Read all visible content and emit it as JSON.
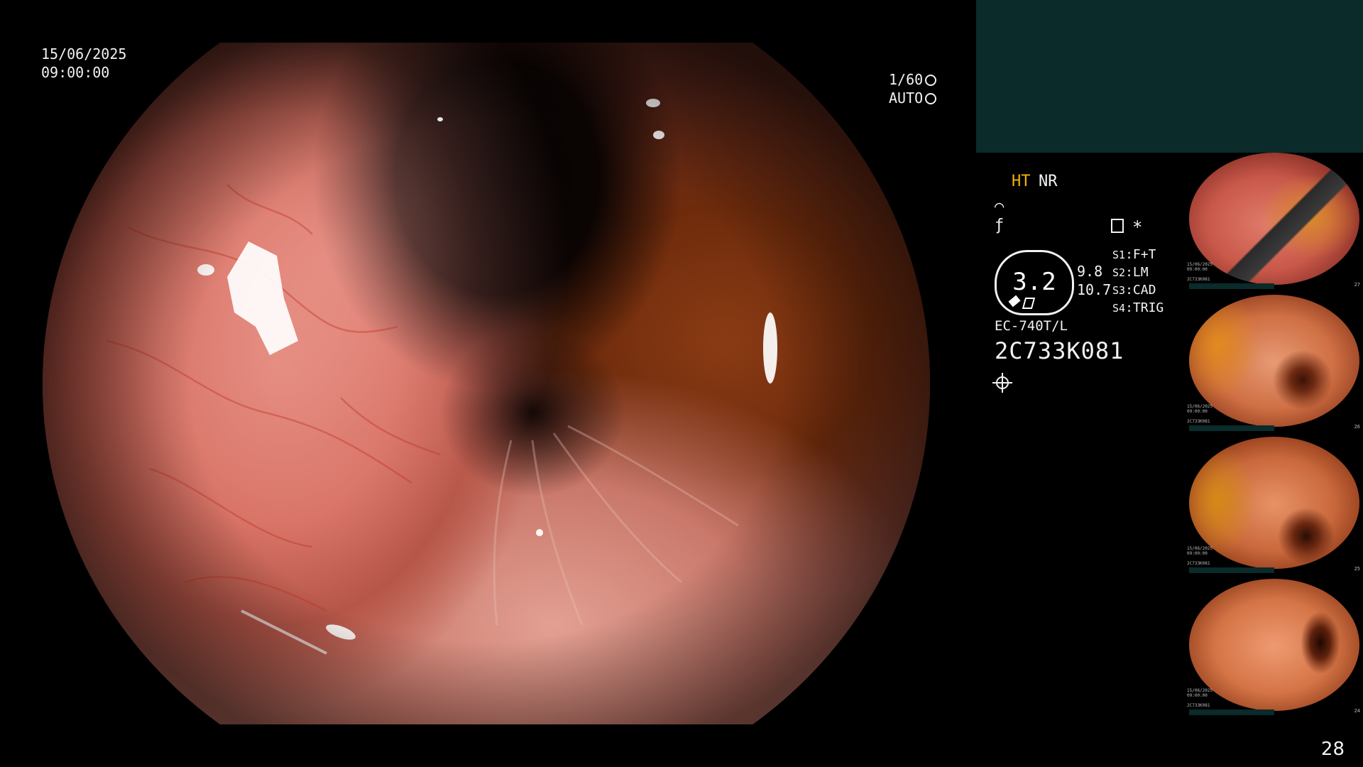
{
  "overlay": {
    "date": "15/06/2025",
    "time": "09:00:00",
    "shutter_speed": "1/60",
    "shutter_icon": "aperture-icon",
    "exposure_mode": "AUTO",
    "exposure_icon": "iris-icon"
  },
  "settings": {
    "ht_label": "HT",
    "nr_label": "NR",
    "ht_color": "#f0b400",
    "structure_icon": "structure-enhancement-icon",
    "freeze_icon": "freeze-icon",
    "record_icon": "document-icon",
    "star_symbol": "*",
    "zoom_value": "3.2",
    "value_a": "9.8",
    "value_b": "10.7",
    "switches": [
      {
        "key": "S1",
        "value": "F+T"
      },
      {
        "key": "S2",
        "value": "LM"
      },
      {
        "key": "S3",
        "value": "CAD"
      },
      {
        "key": "S4",
        "value": "TRIG"
      }
    ],
    "scope_model": "EC-740T/L",
    "scope_serial": "2C733K081",
    "light_icon": "brightness-icon"
  },
  "thumbnails": [
    {
      "number": "27",
      "meta": "15/06/2025\n09:00:00\n\n2C733K081"
    },
    {
      "number": "26",
      "meta": "15/06/2025\n09:00:00\n\n2C733K081"
    },
    {
      "number": "25",
      "meta": "15/06/2025\n09:00:00\n\n2C733K081"
    },
    {
      "number": "24",
      "meta": "15/06/2025\n09:00:00\n\n2C733K081"
    }
  ],
  "page_number": "28"
}
